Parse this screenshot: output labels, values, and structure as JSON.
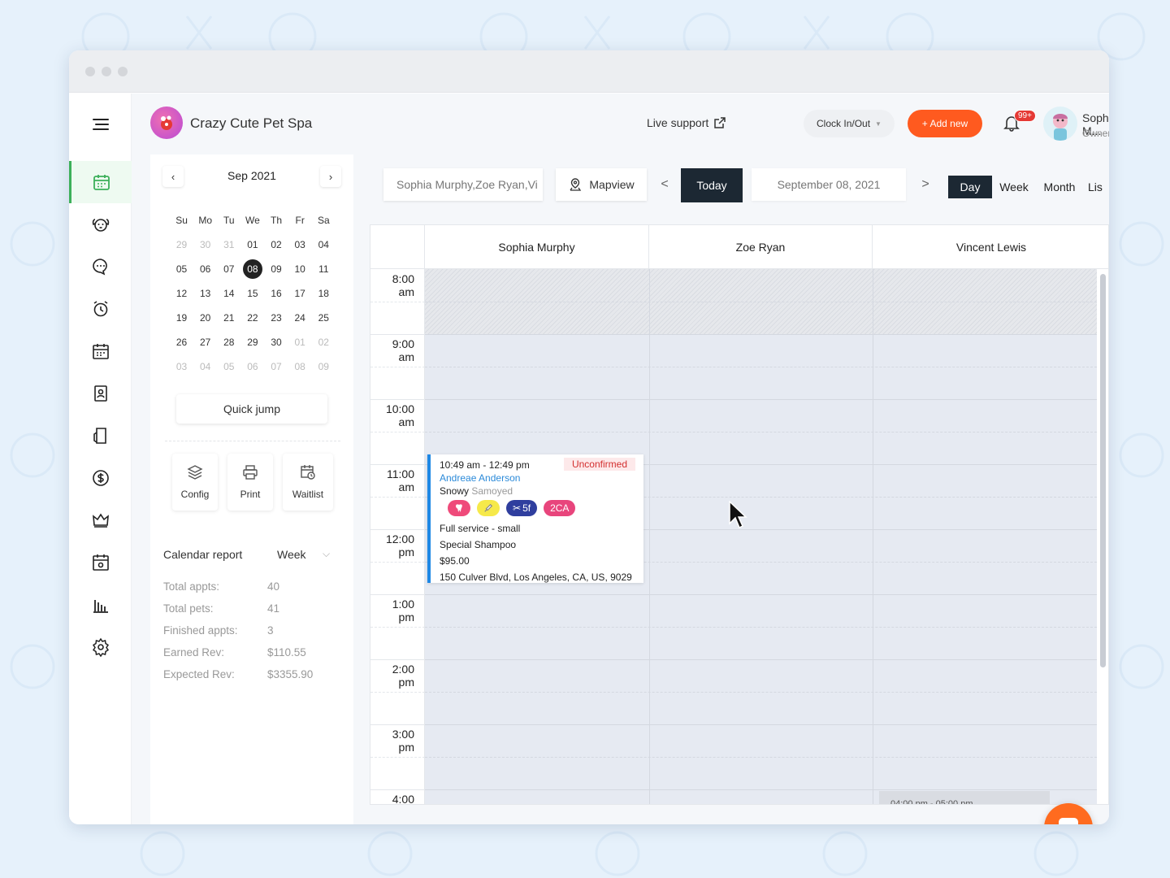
{
  "brand": {
    "name": "Crazy Cute Pet Spa"
  },
  "header": {
    "live_support": "Live support",
    "clock_label": "Clock In/Out",
    "add_new": "+ Add new",
    "notif_count": "99+",
    "user_name": "Sophia M...",
    "user_role": "Owner"
  },
  "sidebar": {
    "items": [
      {
        "icon": "calendar-icon",
        "active": true
      },
      {
        "icon": "dog-icon"
      },
      {
        "icon": "chat-icon"
      },
      {
        "icon": "alarm-icon"
      },
      {
        "icon": "schedule-icon"
      },
      {
        "icon": "contacts-icon"
      },
      {
        "icon": "tablet-icon"
      },
      {
        "icon": "dollar-icon"
      },
      {
        "icon": "crown-icon"
      },
      {
        "icon": "calendar-alt-icon"
      },
      {
        "icon": "bar-chart-icon"
      },
      {
        "icon": "settings-icon"
      }
    ]
  },
  "minical": {
    "title": "Sep 2021",
    "weekdays": [
      "Su",
      "Mo",
      "Tu",
      "We",
      "Th",
      "Fr",
      "Sa"
    ],
    "weeks": [
      [
        "29",
        "30",
        "31",
        "01",
        "02",
        "03",
        "04"
      ],
      [
        "05",
        "06",
        "07",
        "08",
        "09",
        "10",
        "11"
      ],
      [
        "12",
        "13",
        "14",
        "15",
        "16",
        "17",
        "18"
      ],
      [
        "19",
        "20",
        "21",
        "22",
        "23",
        "24",
        "25"
      ],
      [
        "26",
        "27",
        "28",
        "29",
        "30",
        "01",
        "02"
      ],
      [
        "03",
        "04",
        "05",
        "06",
        "07",
        "08",
        "09"
      ]
    ],
    "selected": "08",
    "quick_jump": "Quick jump"
  },
  "tools": {
    "config": "Config",
    "print": "Print",
    "waitlist": "Waitlist"
  },
  "report": {
    "title": "Calendar report",
    "range": "Week",
    "stats": [
      {
        "label": "Total appts:",
        "value": "40"
      },
      {
        "label": "Total pets:",
        "value": "41"
      },
      {
        "label": "Finished appts:",
        "value": "3"
      },
      {
        "label": "Earned Rev:",
        "value": "$110.55"
      },
      {
        "label": "Expected Rev:",
        "value": "$3355.90"
      }
    ]
  },
  "toolbar": {
    "staff_filter": "Sophia Murphy,Zoe Ryan,Vi",
    "mapview": "Mapview",
    "today": "Today",
    "date": "September 08, 2021",
    "views": [
      "Day",
      "Week",
      "Month",
      "Lis"
    ],
    "active_view": "Day"
  },
  "calendar": {
    "staff": [
      "Sophia Murphy",
      "Zoe Ryan",
      "Vincent Lewis"
    ],
    "times": [
      {
        "h": "8:00",
        "p": "am"
      },
      {
        "h": "9:00",
        "p": "am"
      },
      {
        "h": "10:00",
        "p": "am"
      },
      {
        "h": "11:00",
        "p": "am"
      },
      {
        "h": "12:00",
        "p": "pm"
      },
      {
        "h": "1:00",
        "p": "pm"
      },
      {
        "h": "2:00",
        "p": "pm"
      },
      {
        "h": "3:00",
        "p": "pm"
      },
      {
        "h": "4:00",
        "p": ""
      }
    ]
  },
  "appointment": {
    "time": "10:49 am - 12:49 pm",
    "status": "Unconfirmed",
    "client": "Andreae Anderson",
    "pet_name": "Snowy",
    "pet_breed": "Samoyed",
    "tags": [
      {
        "icon": "tooth-icon",
        "label": "",
        "color": "#ef4a7a"
      },
      {
        "icon": "syringe-icon",
        "label": "",
        "color": "#f6e94a"
      },
      {
        "icon": "scissors-icon",
        "label": "5f",
        "color": "#2f3e9e"
      },
      {
        "icon": "",
        "label": "2CA",
        "color": "#e8457c"
      }
    ],
    "service": "Full service - small",
    "addon": "Special Shampoo",
    "price": "$95.00",
    "address": "150 Culver Blvd, Los Angeles, CA, US, 9029"
  },
  "appointment2": {
    "time": "04:00 pm - 05:00 pm"
  },
  "colors": {
    "accent": "#ff5a1f",
    "active_green": "#3db05a",
    "dark": "#1c2833",
    "link": "#2b8ad9"
  }
}
